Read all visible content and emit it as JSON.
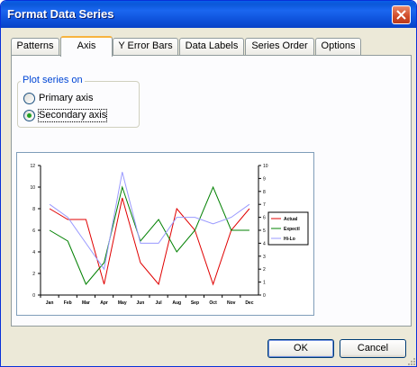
{
  "dialog": {
    "title": "Format Data Series",
    "tabs": [
      {
        "label": "Patterns"
      },
      {
        "label": "Axis"
      },
      {
        "label": "Y Error Bars"
      },
      {
        "label": "Data Labels"
      },
      {
        "label": "Series Order"
      },
      {
        "label": "Options"
      }
    ],
    "active_tab": "Axis",
    "plot_series_on": {
      "group_label": "Plot series on",
      "options": [
        {
          "label": "Primary axis",
          "selected": false
        },
        {
          "label": "Secondary axis",
          "selected": true
        }
      ]
    },
    "buttons": {
      "ok": "OK",
      "cancel": "Cancel"
    }
  },
  "colors": {
    "titlebar": "#0a5fe8",
    "accent_tab": "#f7b33e",
    "group_label": "#0046d5"
  },
  "chart_data": {
    "type": "line",
    "categories": [
      "Jan",
      "Feb",
      "Mar",
      "Apr",
      "May",
      "Jun",
      "Jul",
      "Aug",
      "Sep",
      "Oct",
      "Nov",
      "Dec"
    ],
    "ylim": [
      0,
      12
    ],
    "yticks": [
      0,
      2,
      4,
      6,
      8,
      10,
      12
    ],
    "y2lim": [
      0,
      10
    ],
    "y2ticks": [
      0,
      1,
      2,
      3,
      4,
      5,
      6,
      7,
      8,
      9,
      10
    ],
    "legend_position": "right",
    "series": [
      {
        "name": "Actual",
        "color": "#e00000",
        "axis": "primary",
        "values": [
          8,
          7,
          7,
          1,
          9,
          3,
          1,
          8,
          6,
          1,
          6,
          8
        ]
      },
      {
        "name": "Expectl",
        "color": "#008000",
        "axis": "primary",
        "values": [
          6,
          5,
          1,
          3,
          10,
          5,
          7,
          4,
          6,
          10,
          6,
          6
        ]
      },
      {
        "name": "Hi-Lo",
        "color": "#9999ff",
        "axis": "secondary",
        "values": [
          7,
          6,
          4,
          2,
          9.5,
          4,
          4,
          6,
          6,
          5.5,
          6,
          7
        ]
      }
    ]
  }
}
